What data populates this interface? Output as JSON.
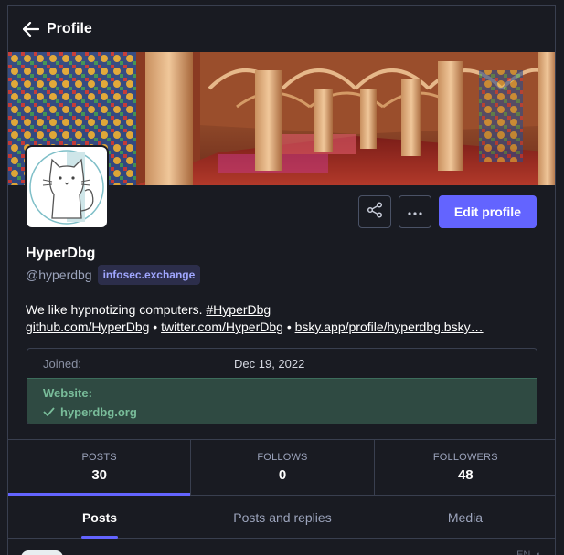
{
  "topbar": {
    "back_label": "Profile",
    "back_icon": "arrow-left-icon"
  },
  "profile": {
    "display_name": "HyperDbg",
    "handle": "@hyperdbg",
    "domain": "infosec.exchange",
    "bio": {
      "text": "We like hypnotizing computers.",
      "hashtag": "#HyperDbg",
      "links": [
        "github.com/HyperDbg",
        "twitter.com/HyperDbg",
        "bsky.app/profile/hyperdbg.bsky…"
      ],
      "separator": "•"
    }
  },
  "actions": {
    "share_icon": "share-icon",
    "more_icon": "more-icon",
    "edit_label": "Edit profile"
  },
  "fields": {
    "joined_label": "Joined:",
    "joined_value": "Dec 19, 2022",
    "website_label": "Website:",
    "website_value": "hyperdbg.org"
  },
  "counters": [
    {
      "label": "POSTS",
      "value": "30"
    },
    {
      "label": "FOLLOWS",
      "value": "0"
    },
    {
      "label": "FOLLOWERS",
      "value": "48"
    }
  ],
  "tabs": [
    {
      "label": "Posts",
      "active": true
    },
    {
      "label": "Posts and replies",
      "active": false
    },
    {
      "label": "Media",
      "active": false
    }
  ],
  "colors": {
    "background": "#191b22",
    "accent": "#6364ff",
    "verified_bg": "#2f4a42",
    "verified_text": "#79bd9a",
    "border": "#393f4f"
  },
  "peek": {
    "lang": "EN"
  }
}
